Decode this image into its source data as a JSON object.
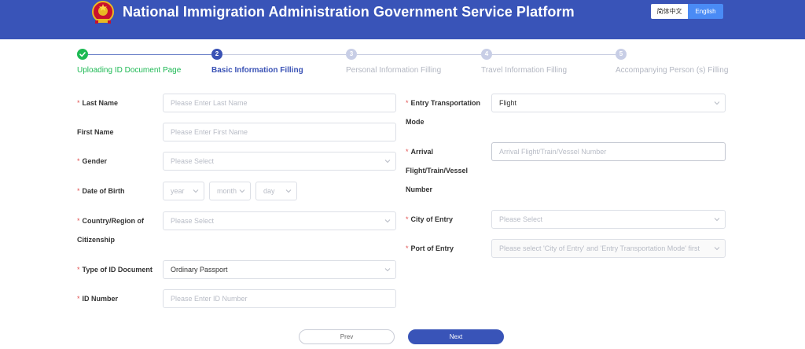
{
  "header": {
    "title": "National Immigration Administration Government Service Platform",
    "lang_zh": "简体中文",
    "lang_en": "English",
    "active_lang": "English",
    "emblem_icon": "national-emblem-icon"
  },
  "steps": [
    {
      "number": "1",
      "label": "Uploading ID Document Page",
      "status": "done",
      "icon": "check-icon"
    },
    {
      "number": "2",
      "label": "Basic Information Filling",
      "status": "active"
    },
    {
      "number": "3",
      "label": "Personal Information Filling",
      "status": "pending"
    },
    {
      "number": "4",
      "label": "Travel Information Filling",
      "status": "pending"
    },
    {
      "number": "5",
      "label": "Accompanying Person (s) Filling",
      "status": "pending"
    }
  ],
  "form": {
    "left": {
      "last_name": {
        "label": "Last Name",
        "required": "*",
        "placeholder": "Please Enter Last Name"
      },
      "first_name": {
        "label": "First Name",
        "placeholder": "Please Enter First Name"
      },
      "gender": {
        "label": "Gender",
        "required": "*",
        "placeholder": "Please Select"
      },
      "dob": {
        "label": "Date of Birth",
        "required": "*",
        "year": "year",
        "month": "month",
        "day": "day"
      },
      "country": {
        "label_line1": "Country/Region of",
        "label_line2": "Citizenship",
        "required": "*",
        "placeholder": "Please Select"
      },
      "id_type": {
        "label": "Type of ID Document",
        "required": "*",
        "value": "Ordinary Passport"
      },
      "id_number": {
        "label": "ID Number",
        "required": "*",
        "placeholder": "Please Enter ID Number"
      }
    },
    "right": {
      "entry_mode": {
        "label_line1": "Entry Transportation",
        "label_line2": "Mode",
        "required": "*",
        "value": "Flight"
      },
      "arrival": {
        "label_line1": "Arrival",
        "label_line2": "Flight/Train/Vessel",
        "label_line3": "Number",
        "required": "*",
        "placeholder": "Arrival Flight/Train/Vessel Number"
      },
      "city": {
        "label": "City of Entry",
        "required": "*",
        "placeholder": "Please Select"
      },
      "port": {
        "label": "Port of Entry",
        "required": "*",
        "placeholder": "Please select 'City of Entry' and 'Entry Transportation Mode' first"
      }
    }
  },
  "buttons": {
    "prev": "Prev",
    "next": "Next"
  },
  "colors": {
    "brand": "#3954b8",
    "success": "#1db954",
    "english_button": "#4a8bf5",
    "required": "#e05050"
  }
}
